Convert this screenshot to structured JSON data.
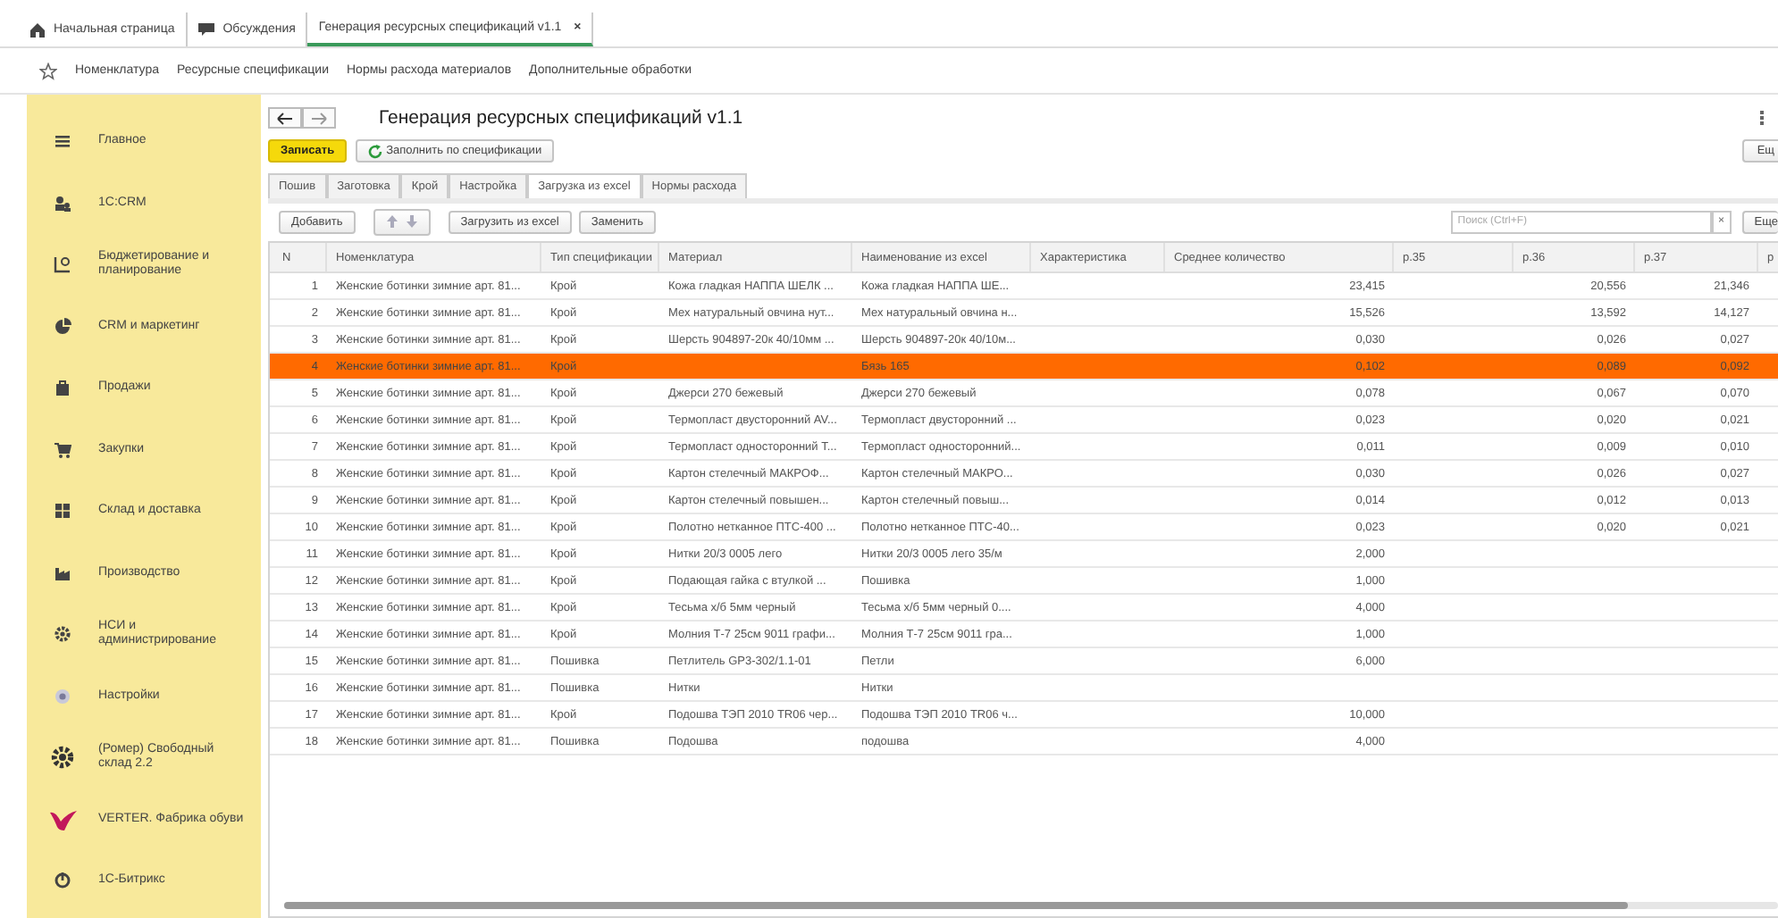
{
  "open_tabs": [
    {
      "label": "Начальная страница",
      "selected": false
    },
    {
      "label": "Обсуждения",
      "selected": false
    },
    {
      "label": "Генерация ресурсных спецификаций v1.1",
      "selected": true,
      "close": "×"
    }
  ],
  "nav_links": [
    "Номенклатура",
    "Ресурсные спецификации",
    "Нормы расхода материалов",
    "Дополнительные обработки"
  ],
  "sidebar": {
    "items": [
      {
        "label": "Главное"
      },
      {
        "label": "1С:CRM"
      },
      {
        "label": "Бюджетирование и планирование"
      },
      {
        "label": "CRM и маркетинг"
      },
      {
        "label": "Продажи"
      },
      {
        "label": "Закупки"
      },
      {
        "label": "Склад и доставка"
      },
      {
        "label": "Производство"
      },
      {
        "label": "НСИ и администрирование"
      },
      {
        "label": "Настройки"
      },
      {
        "label": "(Ромер) Свободный склад 2.2"
      },
      {
        "label": "VERTER. Фабрика обуви"
      },
      {
        "label": "1С-Битрикс"
      }
    ]
  },
  "form": {
    "title": "Генерация ресурсных спецификаций v1.1",
    "buttons": [
      {
        "label": "Записать",
        "kind": "primary"
      },
      {
        "label": "Заполнить по спецификации",
        "kind": "refresh"
      }
    ],
    "more_top": "Ещ",
    "tabs": [
      {
        "label": "Пошив",
        "selected": false
      },
      {
        "label": "Заготовка",
        "selected": false
      },
      {
        "label": "Крой",
        "selected": false
      },
      {
        "label": "Настройка",
        "selected": false
      },
      {
        "label": "Загрузка из excel",
        "selected": true
      },
      {
        "label": "Нормы расхода",
        "selected": false
      }
    ],
    "toolbar": {
      "add": "Добавить",
      "load": "Загрузить из excel",
      "replace": "Заменить",
      "search_placeholder": "Поиск (Ctrl+F)",
      "clear": "×",
      "more": "Еще"
    },
    "table": {
      "columns": [
        "N",
        "Номенклатура",
        "Тип спецификации",
        "Материал",
        "Наименование из excel",
        "Характеристика",
        "Среднее количество",
        "р.35",
        "р.36",
        "р.37",
        "р"
      ],
      "rows": [
        {
          "selected": false,
          "cells": [
            "1",
            "Женские ботинки зимние арт. 81...",
            "Крой",
            "Кожа гладкая НАППА ШЕЛК ...",
            "Кожа гладкая НАППА ШЕ...",
            "",
            "23,415",
            "",
            "20,556",
            "21,346",
            ""
          ]
        },
        {
          "selected": false,
          "cells": [
            "2",
            "Женские ботинки зимние арт. 81...",
            "Крой",
            "Мех натуральный овчина нут...",
            "Мех натуральный овчина н...",
            "",
            "15,526",
            "",
            "13,592",
            "14,127",
            ""
          ]
        },
        {
          "selected": false,
          "cells": [
            "3",
            "Женские ботинки зимние арт. 81...",
            "Крой",
            "Шерсть 904897-20к 40/10мм ...",
            "Шерсть 904897-20к 40/10м...",
            "",
            "0,030",
            "",
            "0,026",
            "0,027",
            ""
          ]
        },
        {
          "selected": true,
          "cells": [
            "4",
            "Женские ботинки зимние арт. 81...",
            "Крой",
            "",
            "Бязь 165",
            "",
            "0,102",
            "",
            "0,089",
            "0,092",
            ""
          ]
        },
        {
          "selected": false,
          "cells": [
            "5",
            "Женские ботинки зимние арт. 81...",
            "Крой",
            "Джерси 270 бежевый",
            "Джерси 270 бежевый",
            "",
            "0,078",
            "",
            "0,067",
            "0,070",
            ""
          ]
        },
        {
          "selected": false,
          "cells": [
            "6",
            "Женские ботинки зимние арт. 81...",
            "Крой",
            "Термопласт двусторонний AV...",
            "Термопласт двусторонний ...",
            "",
            "0,023",
            "",
            "0,020",
            "0,021",
            ""
          ]
        },
        {
          "selected": false,
          "cells": [
            "7",
            "Женские ботинки зимние арт. 81...",
            "Крой",
            "Термопласт односторонний Т...",
            "Термопласт односторонний...",
            "",
            "0,011",
            "",
            "0,009",
            "0,010",
            ""
          ]
        },
        {
          "selected": false,
          "cells": [
            "8",
            "Женские ботинки зимние арт. 81...",
            "Крой",
            "Картон стелечный  МАКРОФ...",
            "Картон стелечный  МАКРО...",
            "",
            "0,030",
            "",
            "0,026",
            "0,027",
            ""
          ]
        },
        {
          "selected": false,
          "cells": [
            "9",
            "Женские ботинки зимние арт. 81...",
            "Крой",
            "Картон стелечный  повышен...",
            "Картон стелечный  повыш...",
            "",
            "0,014",
            "",
            "0,012",
            "0,013",
            ""
          ]
        },
        {
          "selected": false,
          "cells": [
            "10",
            "Женские ботинки зимние арт. 81...",
            "Крой",
            "Полотно нетканное ПТС-400 ...",
            "Полотно нетканное ПТС-40...",
            "",
            "0,023",
            "",
            "0,020",
            "0,021",
            ""
          ]
        },
        {
          "selected": false,
          "cells": [
            "11",
            "Женские ботинки зимние арт. 81...",
            "Крой",
            "Нитки 20/3 0005 лего",
            "Нитки 20/3 0005 лего 35/м",
            "",
            "2,000",
            "",
            "",
            "",
            ""
          ]
        },
        {
          "selected": false,
          "cells": [
            "12",
            "Женские ботинки зимние арт. 81...",
            "Крой",
            "Подающая гайка с втулкой ...",
            "Пошивка",
            "",
            "1,000",
            "",
            "",
            "",
            ""
          ]
        },
        {
          "selected": false,
          "cells": [
            "13",
            "Женские ботинки зимние арт. 81...",
            "Крой",
            "Тесьма х/б 5мм черный",
            "Тесьма х/б 5мм черный 0....",
            "",
            "4,000",
            "",
            "",
            "",
            ""
          ]
        },
        {
          "selected": false,
          "cells": [
            "14",
            "Женские ботинки зимние арт. 81...",
            "Крой",
            "Молния Т-7 25см 9011 графи...",
            "Молния Т-7 25см 9011 гра...",
            "",
            "1,000",
            "",
            "",
            "",
            ""
          ]
        },
        {
          "selected": false,
          "cells": [
            "15",
            "Женские ботинки зимние арт. 81...",
            "Пошивка",
            "Петлитель GP3-302/1.1-01",
            "Петли",
            "",
            "6,000",
            "",
            "",
            "",
            ""
          ]
        },
        {
          "selected": false,
          "cells": [
            "16",
            "Женские ботинки зимние арт. 81...",
            "Пошивка",
            "Нитки",
            "Нитки",
            "",
            "",
            "",
            "",
            "",
            ""
          ]
        },
        {
          "selected": false,
          "cells": [
            "17",
            "Женские ботинки зимние арт. 81...",
            "Крой",
            "Подошва ТЭП 2010 TR06 чер...",
            "Подошва ТЭП 2010 TR06 ч...",
            "",
            "10,000",
            "",
            "",
            "",
            ""
          ]
        },
        {
          "selected": false,
          "cells": [
            "18",
            "Женские ботинки зимние арт. 81...",
            "Пошивка",
            "Подошва",
            "подошва",
            "",
            "4,000",
            "",
            "",
            "",
            ""
          ]
        }
      ]
    }
  }
}
